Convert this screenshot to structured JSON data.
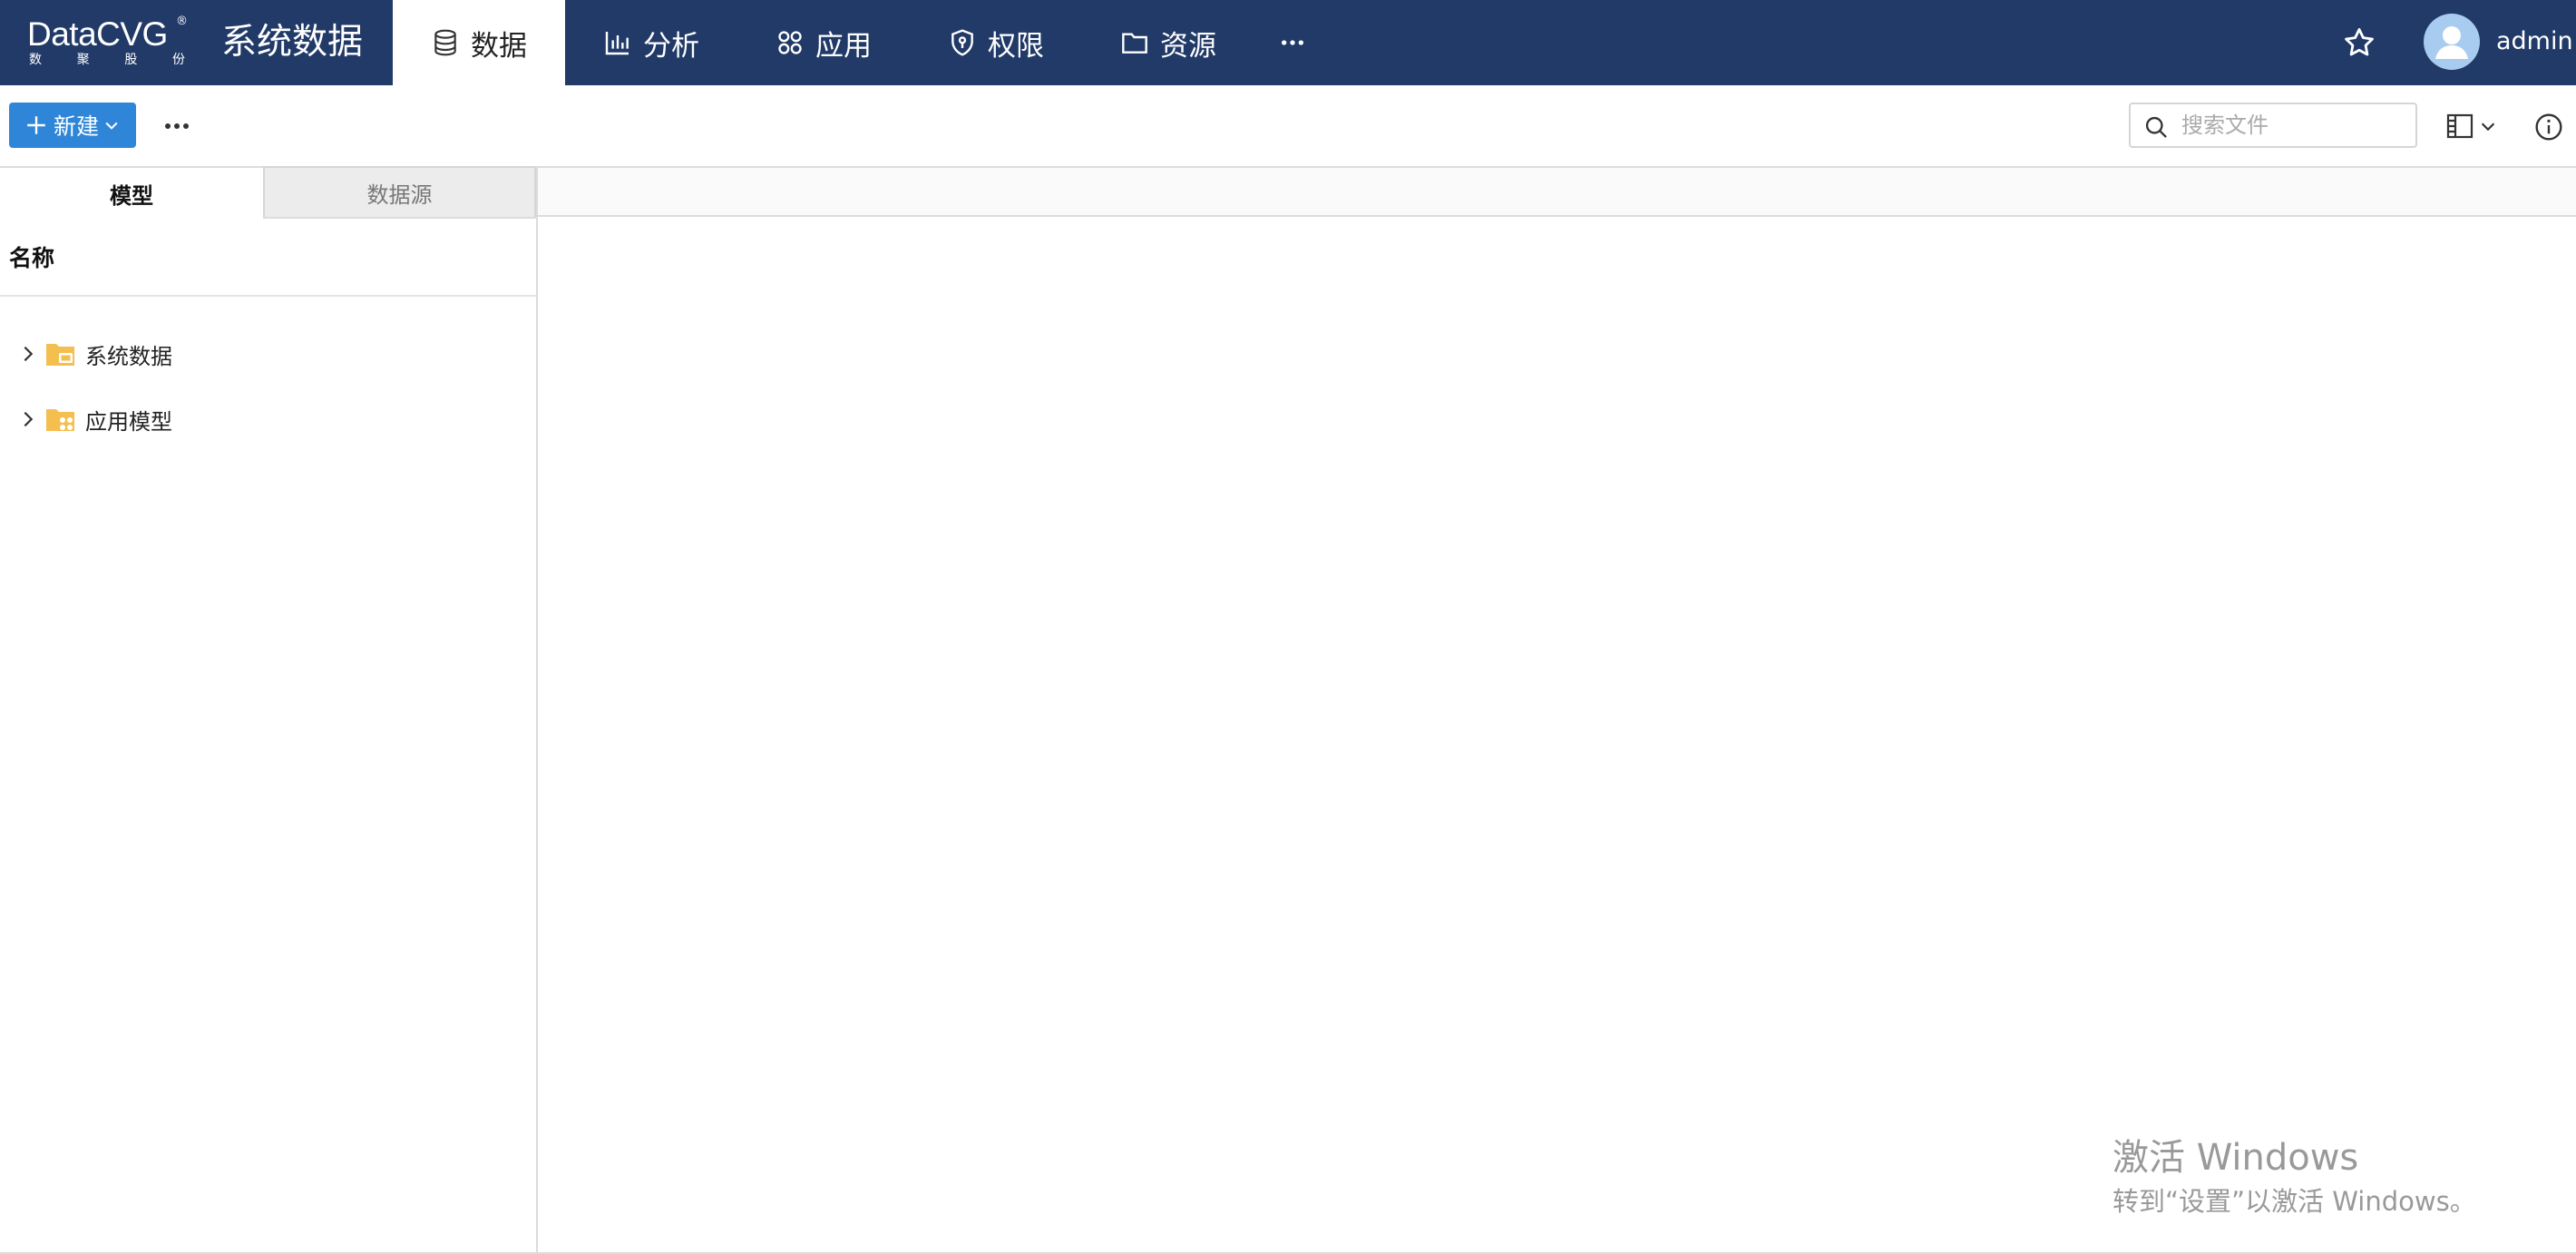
{
  "logo": {
    "brand": "DataCVG",
    "reg_mark": "®",
    "tagline": [
      "数",
      "聚",
      "股",
      "份"
    ]
  },
  "app": {
    "title": "系统数据"
  },
  "nav": {
    "items": [
      {
        "label": "数据",
        "icon": "database-icon",
        "active": true
      },
      {
        "label": "分析",
        "icon": "bar-chart-icon"
      },
      {
        "label": "应用",
        "icon": "apps-grid-icon"
      },
      {
        "label": "权限",
        "icon": "shield-key-icon"
      },
      {
        "label": "资源",
        "icon": "folder-icon"
      }
    ],
    "more_icon": "more-horizontal-icon"
  },
  "header": {
    "favorite_icon": "star-icon",
    "avatar_icon": "user-avatar-icon",
    "username": "admin"
  },
  "toolbar": {
    "new_label": "新建",
    "more_icon": "more-horizontal-icon",
    "search": {
      "placeholder": "搜索文件",
      "value": ""
    },
    "layout_icon": "layout-panel-icon",
    "info_icon": "info-icon"
  },
  "left_panel": {
    "tabs": [
      {
        "label": "模型",
        "active": true
      },
      {
        "label": "数据源",
        "active": false
      }
    ],
    "column_header": "名称",
    "tree": [
      {
        "label": "系统数据",
        "icon": "system-data-folder-icon"
      },
      {
        "label": "应用模型",
        "icon": "app-model-folder-icon"
      }
    ]
  },
  "watermark": {
    "title": "激活 Windows",
    "subtitle": "转到“设置”以激活 Windows。"
  },
  "colors": {
    "topbar": "#213a68",
    "primary": "#2f86d8",
    "folder": "#f5bf4f",
    "avatar": "#a7ccf0"
  }
}
